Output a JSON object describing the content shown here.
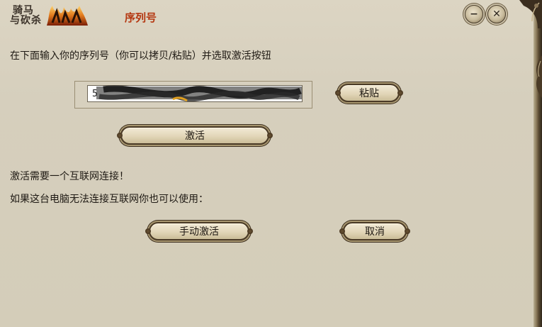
{
  "app": {
    "logo_line1": "骑马",
    "logo_line2": "与砍杀",
    "logo_emblem": "warband-flame-logo",
    "title": "序列号",
    "title_color": "#b4360f"
  },
  "window_controls": {
    "minimize_icon": "minimize-icon",
    "minimize_glyph": "−",
    "close_icon": "close-icon",
    "close_glyph": "✕"
  },
  "serial": {
    "instructions": "在下面输入你的序列号（你可以拷贝/粘贴）并选取激活按钮",
    "value": "5",
    "paste_label": "粘贴",
    "activate_label": "激活"
  },
  "notes": {
    "needs_internet": "激活需要一个互联网连接！",
    "offline_hint": "如果这台电脑无法连接互联网你也可以使用："
  },
  "actions": {
    "manual_activate_label": "手动激活",
    "cancel_label": "取消"
  }
}
